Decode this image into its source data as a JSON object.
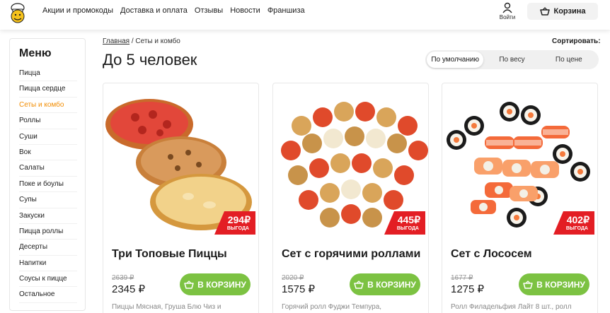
{
  "header": {
    "nav": [
      "Акции и промокоды",
      "Доставка и оплата",
      "Отзывы",
      "Новости",
      "Франшиза"
    ],
    "login_label": "Войти",
    "cart_label": "Корзина"
  },
  "sidebar": {
    "title": "Меню",
    "items": [
      "Пицца",
      "Пицца сердце",
      "Сеты и комбо",
      "Роллы",
      "Суши",
      "Вок",
      "Салаты",
      "Поке и боулы",
      "Супы",
      "Закуски",
      "Пицца роллы",
      "Десерты",
      "Напитки",
      "Соусы к пицце",
      "Остальное"
    ],
    "active": "Сеты и комбо"
  },
  "breadcrumb": {
    "home": "Главная",
    "separator": "/",
    "current": "Сеты и комбо"
  },
  "page": {
    "title": "До 5 человек"
  },
  "sort": {
    "label": "Сортировать:",
    "options": [
      "По умолчанию",
      "По весу",
      "По цене"
    ],
    "selected": "По умолчанию"
  },
  "products": [
    {
      "name": "Три Топовые Пиццы",
      "badge_value": "294₽",
      "badge_label": "ВЫГОДА",
      "old_price": "2639 ₽",
      "price": "2345 ₽",
      "button": "В КОРЗИНУ",
      "description": "Пиццы Мясная, Груша Блю Чиз и"
    },
    {
      "name": "Сет с горячими роллами",
      "badge_value": "445₽",
      "badge_label": "ВЫГОДА",
      "old_price": "2020 ₽",
      "price": "1575 ₽",
      "button": "В КОРЗИНУ",
      "description": "Горячий ролл Фуджи Темпура,"
    },
    {
      "name": "Сет с Лососем",
      "badge_value": "402₽",
      "badge_label": "ВЫГОДА",
      "old_price": "1677 ₽",
      "price": "1275 ₽",
      "button": "В КОРЗИНУ",
      "description": "Ролл Филадельфия Лайт 8 шт., ролл"
    }
  ],
  "colors": {
    "accent": "#f28c00",
    "buy_button": "#7cc242",
    "badge": "#e31e24"
  }
}
